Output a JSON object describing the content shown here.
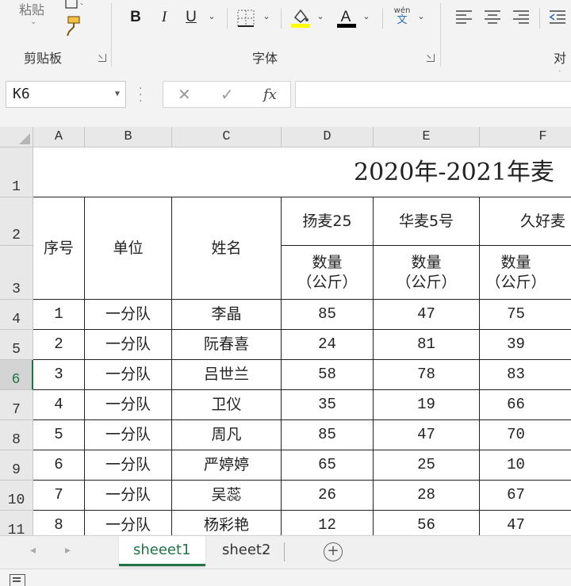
{
  "ribbon": {
    "paste_label": "粘贴",
    "groups": {
      "clipboard": "剪贴板",
      "font": "字体",
      "align": "对齐"
    },
    "font_buttons": {
      "bold": "B",
      "italic": "I",
      "underline": "U",
      "font_color": "A",
      "phonetic_top": "wén",
      "phonetic_bottom": "文"
    },
    "fill_color": "#ffff00",
    "font_color_bar": "#000000"
  },
  "formula_bar": {
    "name_box": "K6",
    "cancel": "✕",
    "enter": "✓",
    "fx": "fx",
    "value": ""
  },
  "columns": [
    "A",
    "B",
    "C",
    "D",
    "E",
    "F"
  ],
  "rows": [
    "1",
    "2",
    "3",
    "4",
    "5",
    "6",
    "7",
    "8",
    "9",
    "10",
    "11"
  ],
  "sheet": {
    "title": "2020年-2021年麦",
    "headers": {
      "seq": "序号",
      "unit": "单位",
      "name": "姓名",
      "variety_1": "扬麦25",
      "variety_2": "华麦5号",
      "variety_3": "久好麦",
      "qty_line1": "数量",
      "qty_line2": "（公斤）"
    },
    "records": [
      {
        "seq": "1",
        "unit": "一分队",
        "name": "李晶",
        "d": "85",
        "e": "47",
        "f": "75"
      },
      {
        "seq": "2",
        "unit": "一分队",
        "name": "阮春喜",
        "d": "24",
        "e": "81",
        "f": "39"
      },
      {
        "seq": "3",
        "unit": "一分队",
        "name": "吕世兰",
        "d": "58",
        "e": "78",
        "f": "83"
      },
      {
        "seq": "4",
        "unit": "一分队",
        "name": "卫仪",
        "d": "35",
        "e": "19",
        "f": "66"
      },
      {
        "seq": "5",
        "unit": "一分队",
        "name": "周凡",
        "d": "85",
        "e": "47",
        "f": "70"
      },
      {
        "seq": "6",
        "unit": "一分队",
        "name": "严婷婷",
        "d": "65",
        "e": "25",
        "f": "10"
      },
      {
        "seq": "7",
        "unit": "一分队",
        "name": "吴蕊",
        "d": "26",
        "e": "28",
        "f": "67"
      },
      {
        "seq": "8",
        "unit": "一分队",
        "name": "杨彩艳",
        "d": "12",
        "e": "56",
        "f": "47"
      }
    ]
  },
  "tabs": [
    {
      "label": "sheeet1",
      "active": true
    },
    {
      "label": "sheet2",
      "active": false
    }
  ],
  "colors": {
    "accent": "#217346",
    "ribbon_bg": "#f3f3f3",
    "header_bg": "#e8e8e8"
  }
}
